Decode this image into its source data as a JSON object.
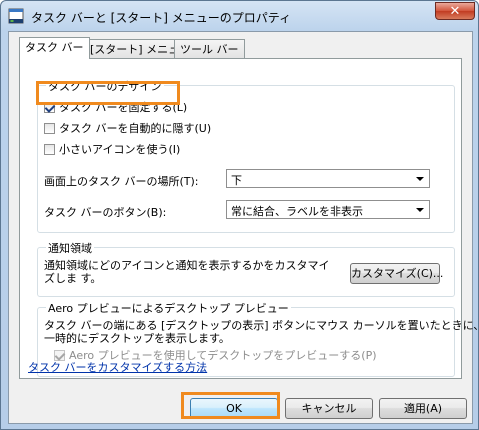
{
  "window": {
    "title": "タスク バーと [スタート] メニューのプロパティ",
    "close_glyph": "✕"
  },
  "tabs": [
    {
      "label": "タスク バー"
    },
    {
      "label": "[スタート] メニュー"
    },
    {
      "label": "ツール バー"
    }
  ],
  "design_group": {
    "label": "タスク バーのデザイン",
    "lock_taskbar": {
      "label": "タスク バーを固定する(L)",
      "checked": true
    },
    "auto_hide": {
      "label": "タスク バーを自動的に隠す(U)",
      "checked": false
    },
    "small_icons": {
      "label": "小さいアイコンを使う(I)",
      "checked": false
    },
    "location": {
      "label": "画面上のタスク バーの場所(T):",
      "value": "下"
    },
    "buttons": {
      "label": "タスク バーのボタン(B):",
      "value": "常に結合、ラベルを非表示"
    }
  },
  "notify_group": {
    "label": "通知領域",
    "text": "通知領域にどのアイコンと通知を表示するかをカスタマイズしま す。",
    "customize_button": "カスタマイズ(C)..."
  },
  "aero_group": {
    "label": "Aero プレビューによるデスクトップ プレビュー",
    "text_line1": "タスク バーの端にある [デスクトップの表示] ボタンにマウス カーソルを置いたときに、",
    "text_line2": "一時的にデスクトップを表示します。",
    "use_peek": {
      "label": "Aero プレビューを使用してデスクトップをプレビューする(P)",
      "checked": true,
      "disabled": true
    }
  },
  "help_link": "タスク バーをカスタマイズする方法",
  "buttons": {
    "ok": "OK",
    "cancel": "キャンセル",
    "apply": "適用(A)"
  },
  "colors": {
    "highlight": "#f08a1e",
    "link": "#0033aa",
    "title_bar": "#bcd3ec"
  }
}
